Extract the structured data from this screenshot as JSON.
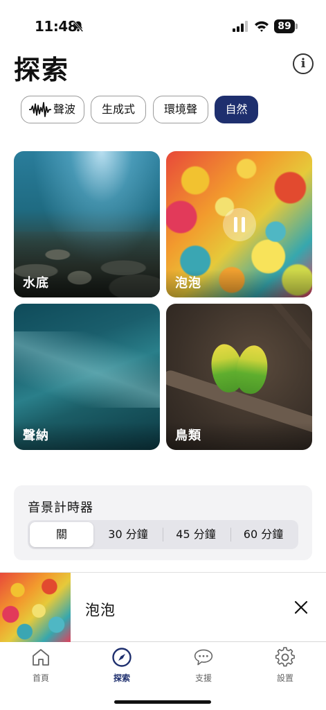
{
  "status_bar": {
    "time": "11:48",
    "battery": "89",
    "bell_icon": "bell-slash-icon",
    "signal_icon": "cellular-signal-icon",
    "wifi_icon": "wifi-icon"
  },
  "header": {
    "title": "探索",
    "info_icon": "info-icon"
  },
  "filters": [
    {
      "label": "聲波",
      "icon": "waveform-icon",
      "active": false
    },
    {
      "label": "生成式",
      "active": false
    },
    {
      "label": "環境聲",
      "active": false
    },
    {
      "label": "自然",
      "active": true
    }
  ],
  "cards": [
    {
      "label": "水底"
    },
    {
      "label": "泡泡",
      "state": "playing",
      "icon": "pause-icon"
    },
    {
      "label": "聲納"
    },
    {
      "label": "鳥類"
    }
  ],
  "timer": {
    "title": "音景計時器",
    "options": [
      "關",
      "30 分鐘",
      "45 分鐘",
      "60 分鐘"
    ],
    "selected": "關"
  },
  "mini_player": {
    "title": "泡泡",
    "close_icon": "close-icon"
  },
  "tab_bar": [
    {
      "label": "首頁",
      "icon": "home-icon",
      "active": false
    },
    {
      "label": "探索",
      "icon": "compass-icon",
      "active": true
    },
    {
      "label": "支援",
      "icon": "chat-bubble-icon",
      "active": false
    },
    {
      "label": "設置",
      "icon": "gear-icon",
      "active": false
    }
  ],
  "colors": {
    "accent": "#1e2f6e",
    "timer_background": "#f3f3f5",
    "segment_track": "#e5e5ea"
  }
}
